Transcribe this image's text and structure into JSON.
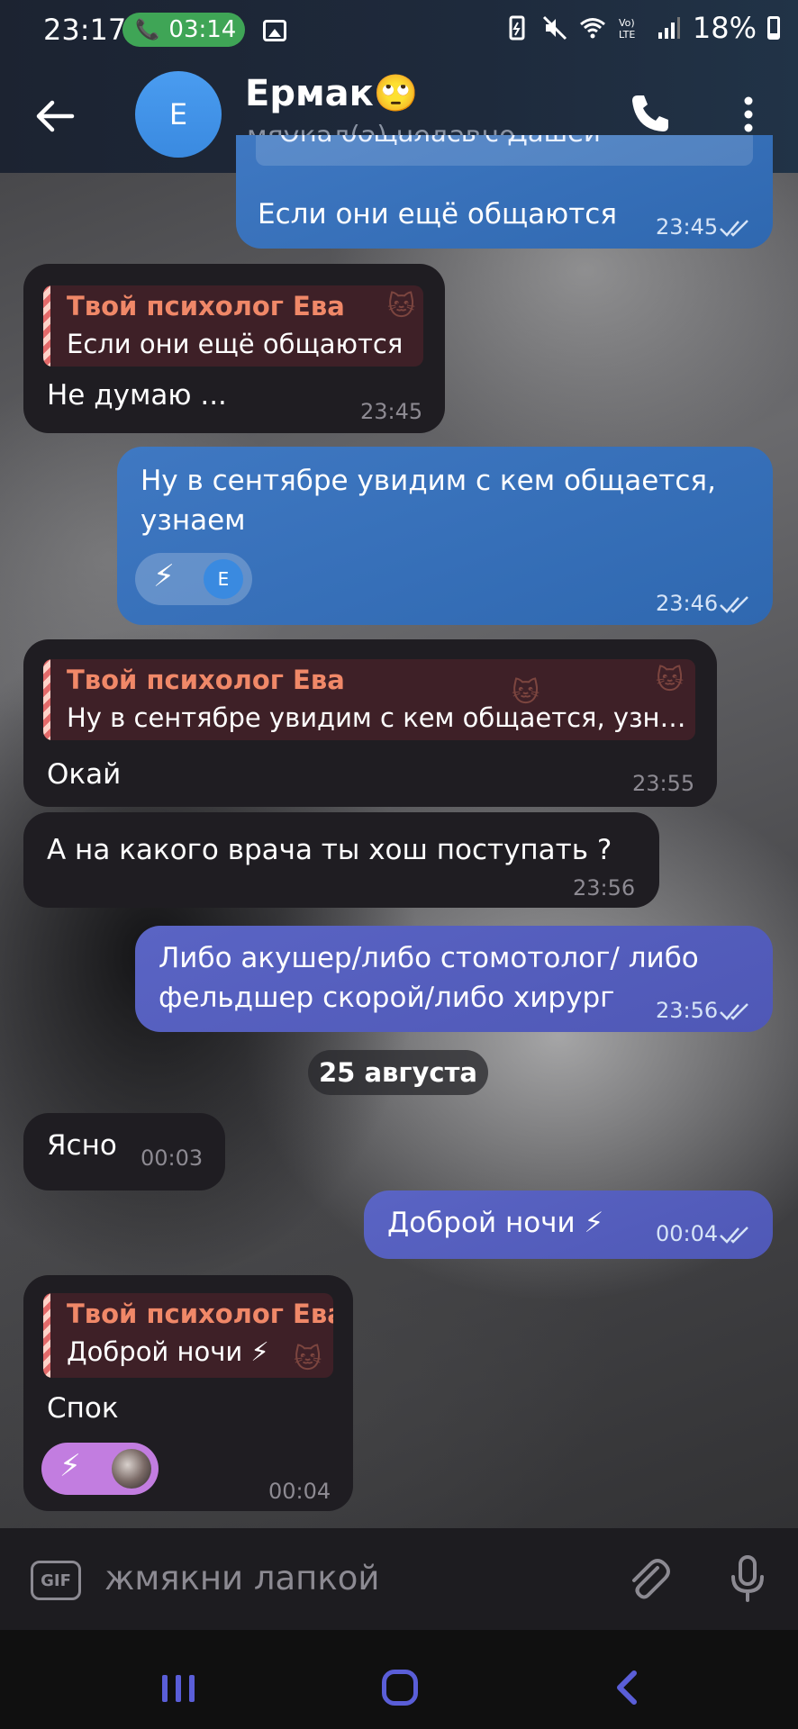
{
  "status_bar": {
    "time": "23:17",
    "call_duration": "03:14",
    "battery": "18%"
  },
  "header": {
    "contact_name": "Ермак🙄",
    "contact_status": "мяукал(а) недавно",
    "avatar_letter": "E"
  },
  "messages": [
    {
      "direction": "out",
      "text": "Если они ещё общаются",
      "time": "23:45",
      "reply_partial": "Она общалась с Дашей"
    },
    {
      "direction": "in",
      "reply_name": "Твой психолог Ева",
      "reply_text": "Если они ещё общаются",
      "text": "Не думаю ...",
      "time": "23:45"
    },
    {
      "direction": "out",
      "text_lines": [
        "Ну в сентябре увидим с кем общается,",
        "узнаем"
      ],
      "time": "23:46",
      "reaction": "⚡",
      "reaction_avatar": "E"
    },
    {
      "direction": "in",
      "reply_name": "Твой психолог Ева",
      "reply_text": "Ну в сентябре увидим с кем общается, узн…",
      "text": "Окай",
      "time": "23:55"
    },
    {
      "direction": "in",
      "text": "А на какого врача ты хош поступать ?",
      "time": "23:56"
    },
    {
      "direction": "out",
      "text_lines": [
        "Либо акушер/либо стомотолог/ либо",
        "фельдшер скорой/либо хирург"
      ],
      "time": "23:56"
    },
    {
      "direction": "in",
      "text": "Ясно",
      "time": "00:03"
    },
    {
      "direction": "out",
      "text": "Доброй ночи ⚡",
      "time": "00:04"
    },
    {
      "direction": "in",
      "reply_name": "Твой психолог Ева",
      "reply_text": "Доброй ночи ⚡",
      "text": "Спок",
      "time": "00:04",
      "reaction": "⚡"
    }
  ],
  "date_separator": "25 августа",
  "input": {
    "placeholder": "жмякни лапкой",
    "gif_label": "GIF"
  },
  "colors": {
    "header_bg": "#1e2a3c",
    "incoming_bubble": "#1f1d22",
    "outgoing_blue": "#3a73bb",
    "outgoing_violet": "#565fbf",
    "reply_name": "#f08868",
    "call_pill": "#3fa556"
  }
}
